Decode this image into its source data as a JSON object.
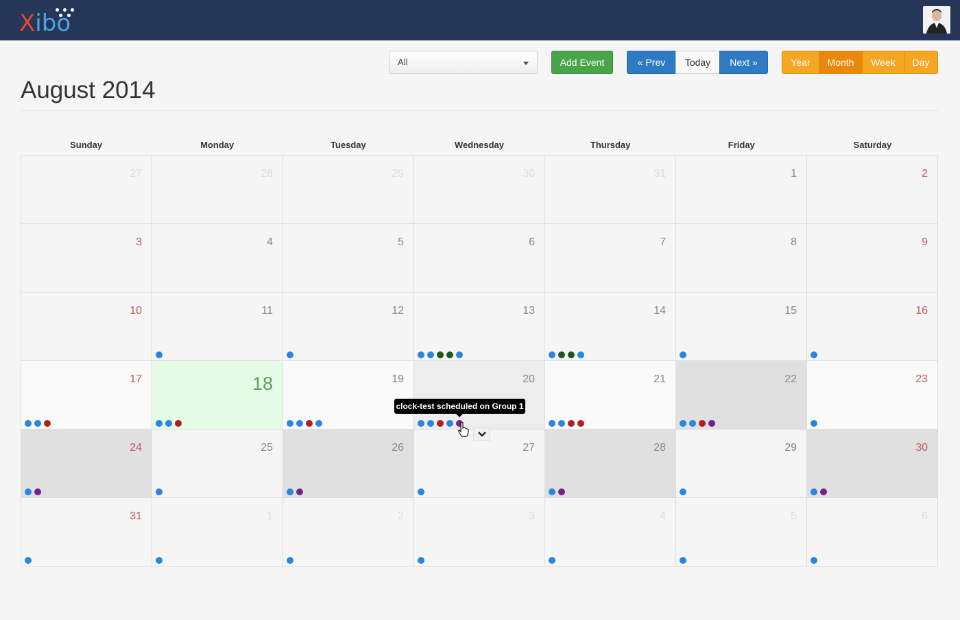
{
  "header": {
    "logo_x": "X",
    "logo_rest": "ibo",
    "avatar_icon": "user-avatar-icon"
  },
  "toolbar": {
    "filter_value": "All",
    "add_event": "Add Event",
    "prev": "« Prev",
    "today": "Today",
    "next": "Next »",
    "year": "Year",
    "month": "Month",
    "week": "Week",
    "day": "Day"
  },
  "calendar": {
    "title": "August 2014",
    "weekdays": [
      "Sunday",
      "Monday",
      "Tuesday",
      "Wednesday",
      "Thursday",
      "Friday",
      "Saturday"
    ],
    "weeks": [
      [
        "27",
        "28",
        "29",
        "30",
        "31",
        "1",
        "2"
      ],
      [
        "3",
        "4",
        "5",
        "6",
        "7",
        "8",
        "9"
      ],
      [
        "10",
        "11",
        "12",
        "13",
        "14",
        "15",
        "16"
      ],
      [
        "17",
        "18",
        "19",
        "20",
        "21",
        "22",
        "23"
      ],
      [
        "24",
        "25",
        "26",
        "27",
        "28",
        "29",
        "30"
      ],
      [
        "31",
        "1",
        "2",
        "3",
        "4",
        "5",
        "6"
      ]
    ],
    "today": "18"
  },
  "tooltip": {
    "text": "clock-test scheduled on Group 1"
  },
  "colors": {
    "blue": "#2a86e0",
    "green": "#1c5a1c",
    "red": "#b02020",
    "purple": "#7a1f8a"
  }
}
